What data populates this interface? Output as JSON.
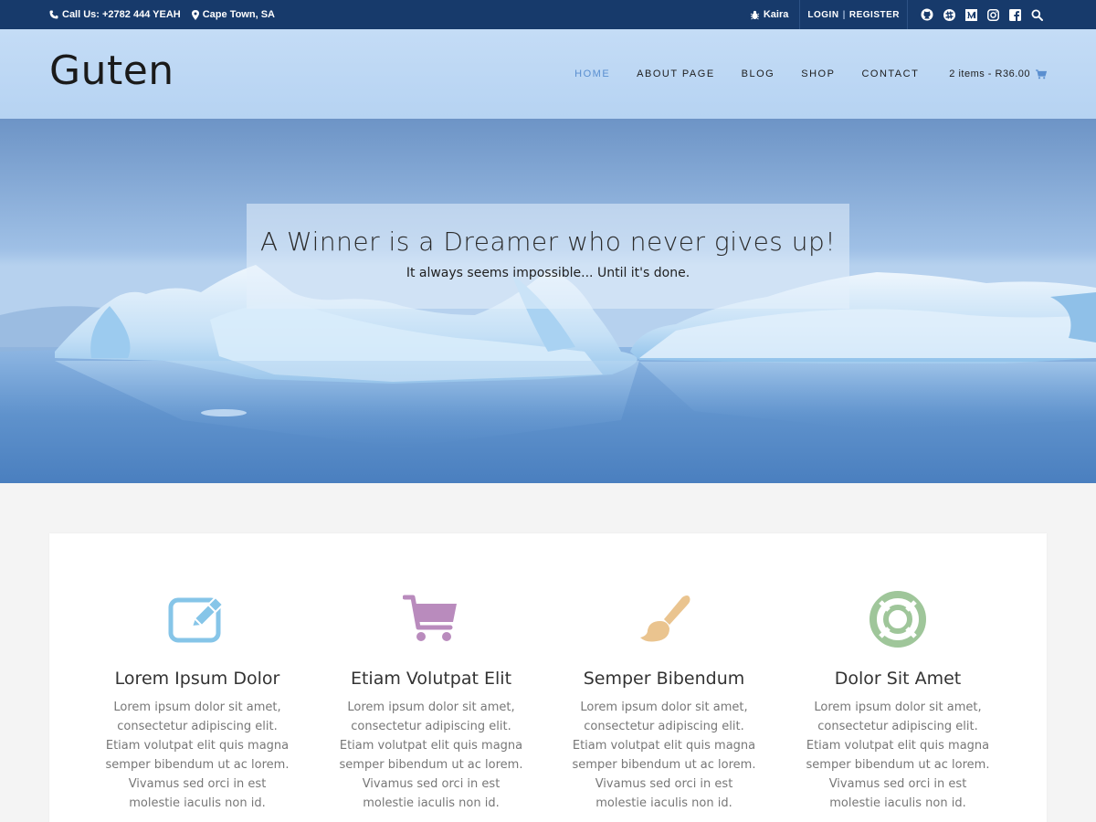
{
  "topbar": {
    "phone": "Call Us: +2782 444 YEAH",
    "location": "Cape Town, SA",
    "kaira": "Kaira",
    "login": "LOGIN",
    "sep": "|",
    "register": "REGISTER",
    "social_icons": [
      "github-icon",
      "slack-icon",
      "medium-icon",
      "instagram-icon",
      "facebook-icon",
      "search-icon"
    ]
  },
  "header": {
    "logo": "Guten",
    "nav": [
      "HOME",
      "ABOUT PAGE",
      "BLOG",
      "SHOP",
      "CONTACT"
    ],
    "active_nav": "HOME",
    "cart": "2 items - R36.00"
  },
  "hero": {
    "title": "A Winner is a Dreamer who never gives up!",
    "subtitle": "It always seems impossible... Until it's done."
  },
  "features": [
    {
      "icon": "edit-icon",
      "color": "#86c5e8",
      "title": "Lorem Ipsum Dolor",
      "text": "Lorem ipsum dolor sit amet, consectetur adipiscing elit. Etiam volutpat elit quis magna semper bibendum ut ac lorem. Vivamus sed orci in est molestie iaculis non id."
    },
    {
      "icon": "cart-icon",
      "color": "#b98bbd",
      "title": "Etiam Volutpat Elit",
      "text": "Lorem ipsum dolor sit amet, consectetur adipiscing elit. Etiam volutpat elit quis magna semper bibendum ut ac lorem. Vivamus sed orci in est molestie iaculis non id."
    },
    {
      "icon": "paintbrush-icon",
      "color": "#eac48f",
      "title": "Semper Bibendum",
      "text": "Lorem ipsum dolor sit amet, consectetur adipiscing elit. Etiam volutpat elit quis magna semper bibendum ut ac lorem. Vivamus sed orci in est molestie iaculis non id."
    },
    {
      "icon": "life-ring-icon",
      "color": "#9fc69a",
      "title": "Dolor Sit Amet",
      "text": "Lorem ipsum dolor sit amet, consectetur adipiscing elit. Etiam volutpat elit quis magna semper bibendum ut ac lorem. Vivamus sed orci in est molestie iaculis non id."
    }
  ]
}
